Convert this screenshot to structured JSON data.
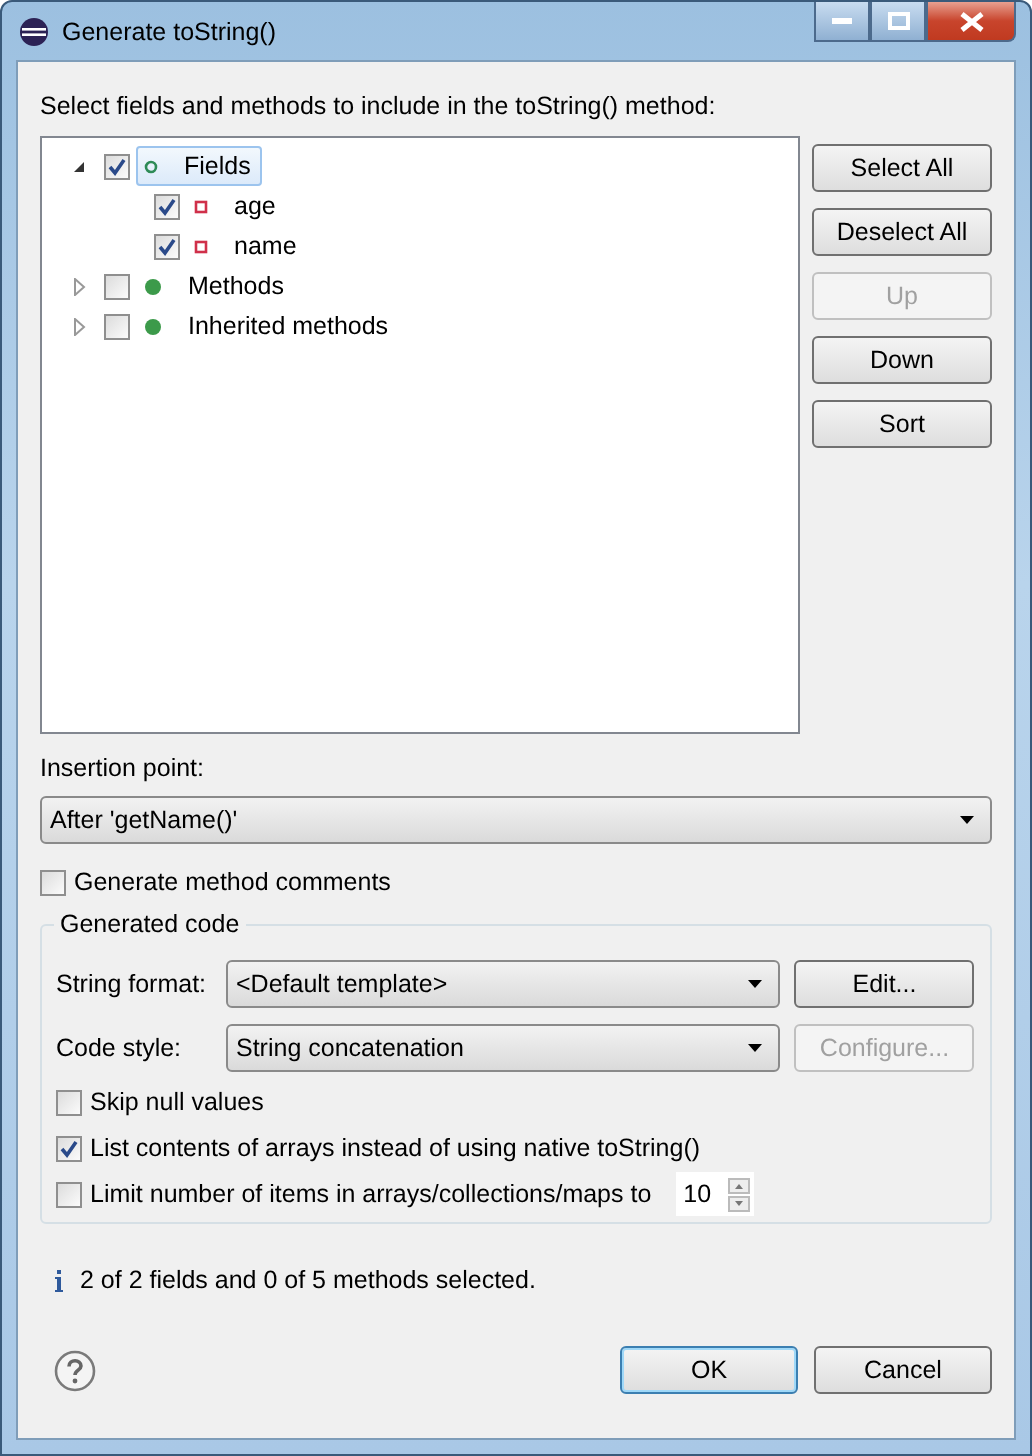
{
  "window": {
    "title": "Generate toString()"
  },
  "instruction": "Select fields and methods to include in the toString() method:",
  "tree": [
    {
      "label": "Fields",
      "kind": "field-group",
      "expanded": true,
      "checked": true,
      "selected": true,
      "children": [
        {
          "label": "age",
          "kind": "field",
          "checked": true,
          "selected": false
        },
        {
          "label": "name",
          "kind": "field",
          "checked": true,
          "selected": false
        }
      ]
    },
    {
      "label": "Methods",
      "kind": "method",
      "expanded": false,
      "checked": false,
      "selected": false
    },
    {
      "label": "Inherited methods",
      "kind": "method",
      "expanded": false,
      "checked": false,
      "selected": false
    }
  ],
  "side_buttons": [
    {
      "label": "Select All",
      "disabled": false
    },
    {
      "label": "Deselect All",
      "disabled": false
    },
    {
      "label": "Up",
      "disabled": true
    },
    {
      "label": "Down",
      "disabled": false
    },
    {
      "label": "Sort",
      "disabled": false
    }
  ],
  "insertion_point": {
    "label": "Insertion point:",
    "value": "After 'getName()'"
  },
  "generate_comments": {
    "label": "Generate method comments",
    "checked": false
  },
  "generated_code": {
    "title": "Generated code",
    "rows": [
      {
        "label": "String format:",
        "value": "<Default template>",
        "button": {
          "label": "Edit...",
          "disabled": false
        }
      },
      {
        "label": "Code style:",
        "value": "String concatenation",
        "button": {
          "label": "Configure...",
          "disabled": true
        }
      }
    ],
    "options": [
      {
        "kind": "checkbox",
        "label": "Skip null values",
        "checked": false
      },
      {
        "kind": "checkbox",
        "label": "List contents of arrays instead of using native toString()",
        "checked": true
      },
      {
        "kind": "spinner",
        "label": "Limit number of items in arrays/collections/maps to",
        "checked": false,
        "value": "10"
      }
    ]
  },
  "status": "2 of 2 fields and 0 of 5 methods selected.",
  "buttons": [
    {
      "label": "OK",
      "default": true
    },
    {
      "label": "Cancel",
      "default": false
    }
  ]
}
